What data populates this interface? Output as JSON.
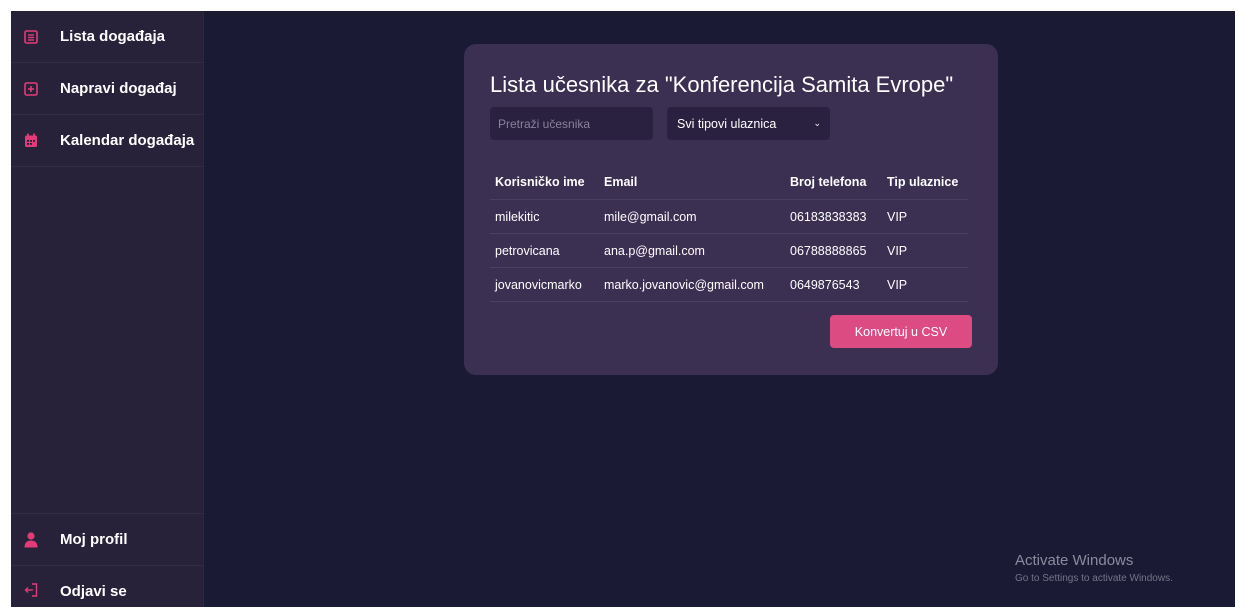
{
  "colors": {
    "background": "#1b1a34",
    "sidebar": "#28213a",
    "card": "#3b2f52",
    "accent": "#dc4c83",
    "icon_accent": "#e23c78"
  },
  "sidebar": {
    "items": [
      {
        "label": "Lista događaja",
        "icon": "list-icon"
      },
      {
        "label": "Napravi događaj",
        "icon": "plus-square-icon"
      },
      {
        "label": "Kalendar događaja",
        "icon": "calendar-icon"
      }
    ],
    "bottom_items": [
      {
        "label": "Moj profil",
        "icon": "user-icon"
      },
      {
        "label": "Odjavi se",
        "icon": "logout-icon"
      }
    ]
  },
  "card": {
    "title": "Lista učesnika za \"Konferencija Samita Evrope\"",
    "search_placeholder": "Pretraži učesnika",
    "search_value": "",
    "ticket_filter": "Svi tipovi ulaznica",
    "table": {
      "headers": [
        "Korisničko ime",
        "Email",
        "Broj telefona",
        "Tip ulaznice"
      ],
      "rows": [
        [
          "milekitic",
          "mile@gmail.com",
          "06183838383",
          "VIP"
        ],
        [
          "petrovicana",
          "ana.p@gmail.com",
          "06788888865",
          "VIP"
        ],
        [
          "jovanovicmarko",
          "marko.jovanovic@gmail.com",
          "0649876543",
          "VIP"
        ]
      ]
    },
    "csv_button": "Konvertuj u CSV"
  },
  "watermark": {
    "title": "Activate Windows",
    "subtitle": "Go to Settings to activate Windows."
  }
}
